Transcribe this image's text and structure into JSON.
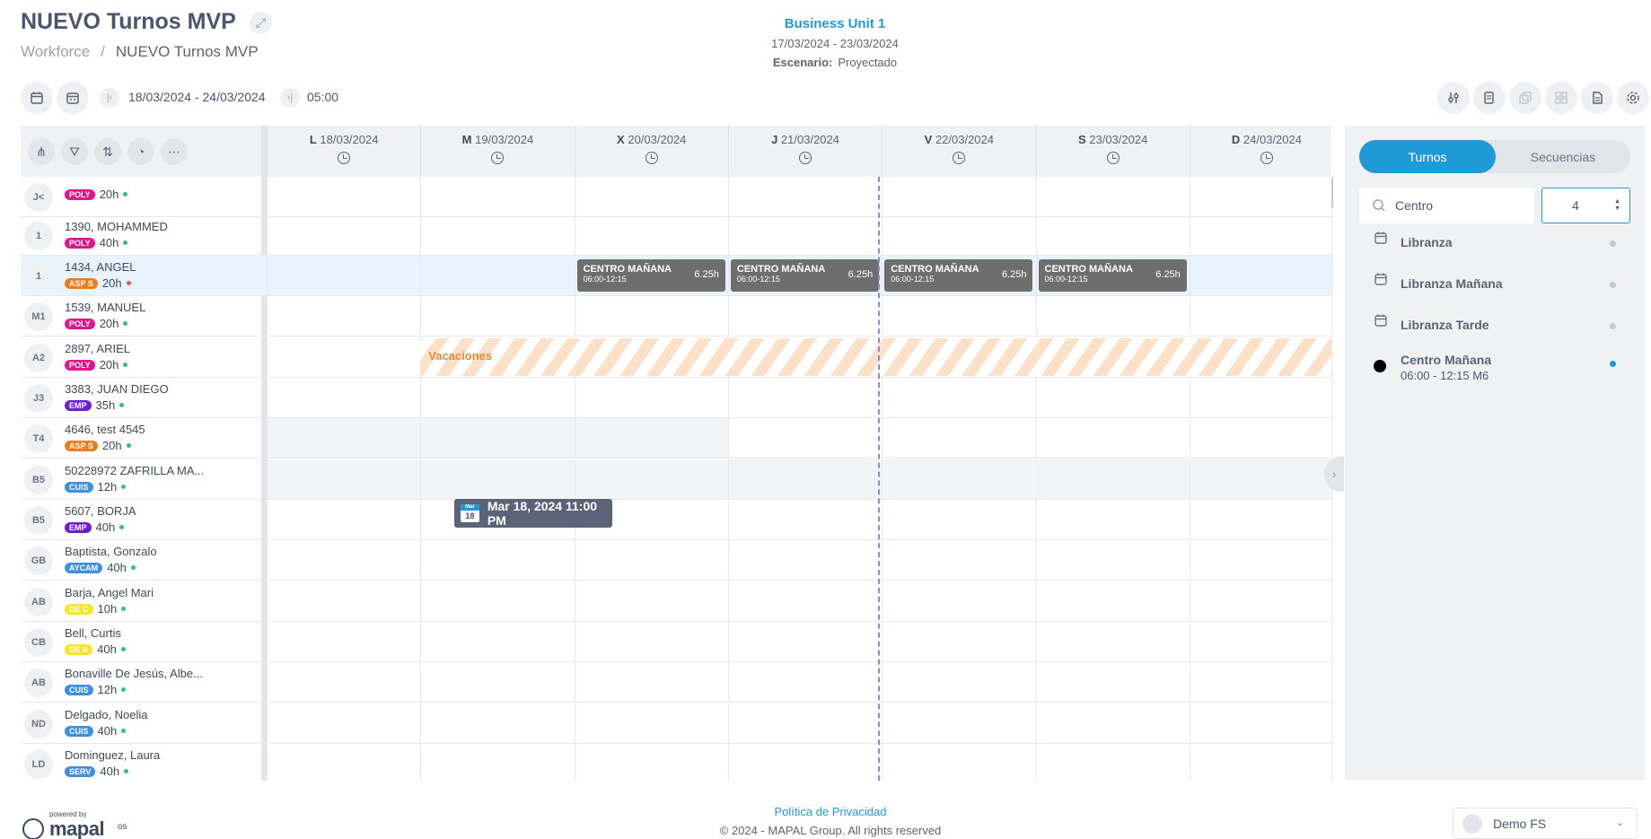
{
  "header": {
    "title": "NUEVO Turnos MVP",
    "breadcrumb": {
      "root": "Workforce",
      "separator": "/",
      "current": "NUEVO Turnos MVP"
    }
  },
  "business_unit": {
    "name": "Business Unit 1",
    "dates": "17/03/2024 - 23/03/2024",
    "scenario_label": "Escenario:",
    "scenario_value": "Proyectado"
  },
  "toolbar": {
    "date_range": "18/03/2024 - 24/03/2024",
    "time": "05:00"
  },
  "days": [
    {
      "abbr": "L",
      "date": "18/03/2024"
    },
    {
      "abbr": "M",
      "date": "19/03/2024"
    },
    {
      "abbr": "X",
      "date": "20/03/2024"
    },
    {
      "abbr": "J",
      "date": "21/03/2024"
    },
    {
      "abbr": "V",
      "date": "22/03/2024"
    },
    {
      "abbr": "S",
      "date": "23/03/2024"
    },
    {
      "abbr": "D",
      "date": "24/03/2024"
    }
  ],
  "employees": [
    {
      "initials": "J<",
      "name": "",
      "badge": "POLY",
      "badge_color": "#e0148c",
      "hours": "20h",
      "status": "#2ec47a"
    },
    {
      "initials": "1",
      "name": "1390, MOHAMMED",
      "badge": "POLY",
      "badge_color": "#e0148c",
      "hours": "40h",
      "status": "#2ec47a"
    },
    {
      "initials": "1",
      "name": "1434, ANGEL",
      "badge": "ASP S",
      "badge_color": "#f27a1a",
      "hours": "20h",
      "status": "#ef4f4f"
    },
    {
      "initials": "M1",
      "name": "1539, MANUEL",
      "badge": "POLY",
      "badge_color": "#e0148c",
      "hours": "20h",
      "status": "#2ec47a"
    },
    {
      "initials": "A2",
      "name": "2897, ARIEL",
      "badge": "POLY",
      "badge_color": "#e0148c",
      "hours": "20h",
      "status": "#2ec47a"
    },
    {
      "initials": "J3",
      "name": "3383, JUAN DIEGO",
      "badge": "EMP",
      "badge_color": "#6a1fd1",
      "hours": "35h",
      "status": "#2ec47a"
    },
    {
      "initials": "T4",
      "name": "4646, test 4545",
      "badge": "ASP S",
      "badge_color": "#f27a1a",
      "hours": "20h",
      "status": "#2ec47a"
    },
    {
      "initials": "B5",
      "name": "50228972 ZAFRILLA MA...",
      "badge": "CUIS",
      "badge_color": "#3f8fe0",
      "hours": "12h",
      "status": "#2ec47a"
    },
    {
      "initials": "B5",
      "name": "5607, BORJA",
      "badge": "EMP",
      "badge_color": "#6a1fd1",
      "hours": "40h",
      "status": "#2ec47a"
    },
    {
      "initials": "GB",
      "name": "Baptista, Gonzalo",
      "badge": "AYCAM",
      "badge_color": "#3f8fe0",
      "hours": "40h",
      "status": "#2ec47a"
    },
    {
      "initials": "AB",
      "name": "Barja, Angel Mari",
      "badge": "DE C",
      "badge_color": "#f5e62a",
      "hours": "10h",
      "status": "#2ec47a"
    },
    {
      "initials": "CB",
      "name": "Bell, Curtis",
      "badge": "DE A",
      "badge_color": "#f5e62a",
      "hours": "40h",
      "status": "#2ec47a"
    },
    {
      "initials": "AB",
      "name": "Bonaville De Jesús, Albe...",
      "badge": "CUIS",
      "badge_color": "#3f8fe0",
      "hours": "12h",
      "status": "#2ec47a"
    },
    {
      "initials": "ND",
      "name": "Delgado, Noelia",
      "badge": "CUIS",
      "badge_color": "#3f8fe0",
      "hours": "40h",
      "status": "#2ec47a"
    },
    {
      "initials": "LD",
      "name": "Dominguez, Laura",
      "badge": "SERV",
      "badge_color": "#3f8fe0",
      "hours": "40h",
      "status": "#2ec47a"
    }
  ],
  "shifts": [
    {
      "name": "CENTRO MAÑANA",
      "time": "06:00-12:15",
      "duration": "6.25h"
    },
    {
      "name": "CENTRO MAÑANA",
      "time": "06:00-12:15",
      "duration": "6.25h"
    },
    {
      "name": "CENTRO MAÑANA",
      "time": "06:00-12:15",
      "duration": "6.25h"
    },
    {
      "name": "CENTRO MAÑANA",
      "time": "06:00-12:15",
      "duration": "6.25h"
    }
  ],
  "vacation_label": "Vacaciones",
  "tooltip": {
    "month": "Mar",
    "day": "18",
    "text": "Mar 18, 2024 11:00 PM"
  },
  "right_panel": {
    "tabs": [
      "Turnos",
      "Secuencias"
    ],
    "search_value": "Centro",
    "number_value": "4",
    "items": [
      {
        "name": "Libranza",
        "sub": "",
        "icon": "calendar-icon"
      },
      {
        "name": "Libranza Mañana",
        "sub": "",
        "icon": "calendar-icon"
      },
      {
        "name": "Libranza Tarde",
        "sub": "",
        "icon": "calendar-icon"
      },
      {
        "name": "Centro Mañana",
        "sub": "06:00 - 12:15   M6",
        "icon": "black-dot-icon"
      }
    ]
  },
  "footer": {
    "powered_by": "powered by",
    "brand": "mapal",
    "brand_suffix": "os",
    "privacy": "Política de Privacidad",
    "copyright": "© 2024 - MAPAL Group. All rights reserved",
    "user": "Demo FS"
  },
  "colors": {
    "accent": "#1f9ad6",
    "shift": "#6e6e6e",
    "vacation": "#fbe1c8",
    "today_line": "#8f87d9"
  }
}
